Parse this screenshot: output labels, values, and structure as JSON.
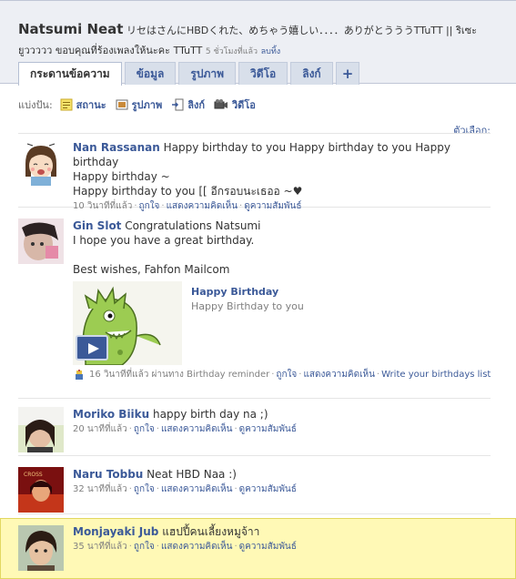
{
  "header": {
    "profile_name": "Natsumi Neat",
    "status_line1": "ริเซはさんにHBDくれた、めちゃう嬉しい．．．．ありがとうううTTuTT || ริเซะยูววววว ขอบคุณที่ร้องเพลงให้นะคะ TTuTT",
    "status_line1_part": "リセはさんにHBDくれた、めちゃう嬉しい．．．．ありがとうううTTuTT || ริเซะ",
    "status_line2": "ยูววววว ขอบคุณที่ร้องเพลงให้นะคะ TTuTT",
    "status_time": "5 ชั่วโมงที่แล้ว",
    "clear_label": "ลบทิ้ง"
  },
  "tabs": [
    {
      "label": "กระดานข้อความ",
      "active": true
    },
    {
      "label": "ข้อมูล",
      "active": false
    },
    {
      "label": "รูปภาพ",
      "active": false
    },
    {
      "label": "วิดีโอ",
      "active": false
    },
    {
      "label": "ลิงก์",
      "active": false
    },
    {
      "label": "+",
      "active": false
    }
  ],
  "share": {
    "label": "แบ่งปัน:",
    "items": [
      {
        "label": "สถานะ",
        "icon": "status-icon"
      },
      {
        "label": "รูปภาพ",
        "icon": "photo-icon"
      },
      {
        "label": "ลิงก์",
        "icon": "link-icon"
      },
      {
        "label": "วิดีโอ",
        "icon": "video-icon"
      }
    ]
  },
  "options_label": "ตัวเลือก:",
  "actions": {
    "like": "ถูกใจ",
    "comment": "แสดงความคิดเห็น",
    "see_relationship": "ดูความสัมพันธ์"
  },
  "posts": [
    {
      "author": "Nan Rassanan",
      "text_line1": "Happy birthday to you Happy birthday to you Happy birthday",
      "text_line2": "Happy birthday ~",
      "text_line3": "Happy birthday to you [[ อีกรอบนะเธออ ~♥",
      "time": "10 วินาทีที่แล้ว"
    },
    {
      "author": "Gin Slot",
      "text_line1": "Congratulations Natsumi",
      "text_line2": "I hope you have a great birthday.",
      "text_line3": "Best wishes, Fahfon Mailcom",
      "attachment_title": "Happy Birthday",
      "attachment_desc": "Happy Birthday to you",
      "reminder_time": "16 วินาทีที่แล้ว",
      "reminder_via": "ผ่านทาง Birthday reminder",
      "reminder_link": "Write your birthdays list"
    },
    {
      "author": "Moriko Biiku",
      "text": "happy birth day na ;)",
      "time": "20 นาทีที่แล้ว"
    },
    {
      "author": "Naru Tobbu",
      "text": "Neat HBD Naa :)",
      "time": "32 นาทีที่แล้ว"
    },
    {
      "author": "Monjayaki Jub",
      "text": "แฮปปี้คนเลี้ยงหมูจ้าา",
      "time": "35 นาทีที่แล้ว"
    }
  ]
}
